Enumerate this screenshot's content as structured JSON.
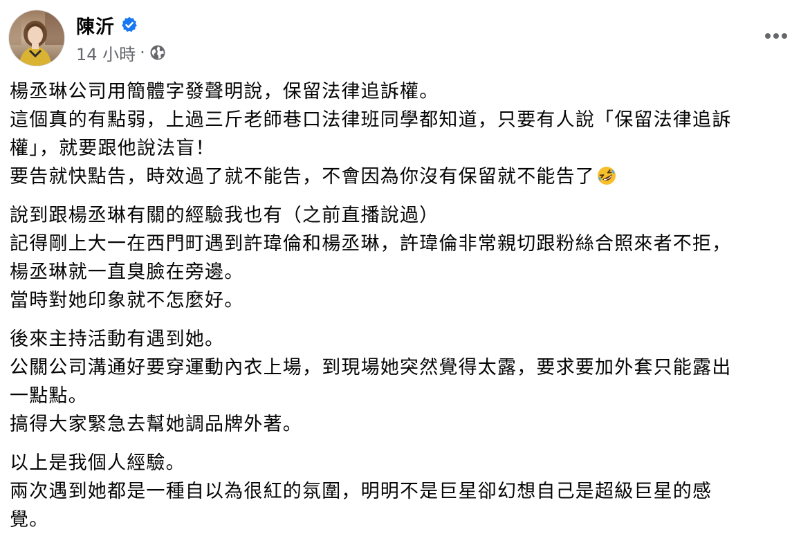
{
  "post": {
    "author": {
      "name": "陳沂",
      "verified_icon": "verified-badge-icon",
      "avatar_icon": "profile-photo"
    },
    "meta": {
      "timestamp": "14 小時",
      "separator": "·",
      "audience_icon": "globe-icon"
    },
    "more_icon": "more-options-icon",
    "paragraphs": [
      {
        "lines": [
          "楊丞琳公司用簡體字發聲明說，保留法律追訴權。",
          "這個真的有點弱，上過三斤老師巷口法律班同學都知道，只要有人說「保留法律追訴",
          "權」，就要跟他說法盲！",
          "要告就快點告，時效過了就不能告，不會因為你沒有保留就不能告了"
        ],
        "trailing_emoji": "rolling-on-floor-laughing-emoji-icon"
      },
      {
        "lines": [
          "說到跟楊丞琳有關的經驗我也有（之前直播說過）",
          "記得剛上大一在西門町遇到許瑋倫和楊丞琳，許瑋倫非常親切跟粉絲合照來者不拒，",
          "楊丞琳就一直臭臉在旁邊。",
          "當時對她印象就不怎麼好。"
        ]
      },
      {
        "lines": [
          "後來主持活動有遇到她。",
          "公關公司溝通好要穿運動內衣上場，到現場她突然覺得太露，要求要加外套只能露出",
          "一點點。",
          "搞得大家緊急去幫她調品牌外著。"
        ]
      },
      {
        "lines": [
          "以上是我個人經驗。",
          "兩次遇到她都是一種自以為很紅的氛圍，明明不是巨星卻幻想自己是超級巨星的感",
          "覺。"
        ]
      }
    ]
  },
  "colors": {
    "text": "#050505",
    "secondary_text": "#65676b",
    "verified_blue": "#1877f2",
    "background": "#ffffff"
  }
}
